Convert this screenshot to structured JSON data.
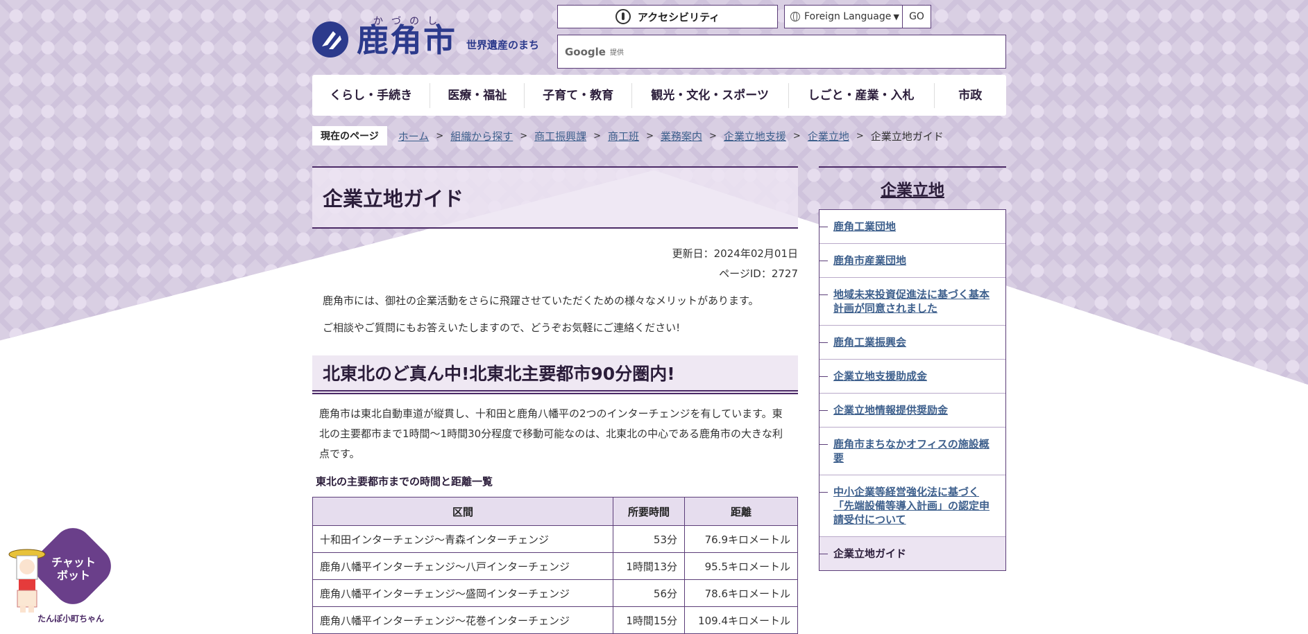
{
  "header": {
    "logo_ruby": "かづのし",
    "logo_name": "鹿角市",
    "logo_sub": "世界遺産のまち",
    "accessibility_label": "アクセシビリティ",
    "language_label": "Foreign Language",
    "go_label": "GO",
    "search_brand": "Google",
    "search_provided": "提供"
  },
  "nav": {
    "items": [
      "くらし・手続き",
      "医療・福祉",
      "子育て・教育",
      "観光・文化・スポーツ",
      "しごと・産業・入札",
      "市政"
    ]
  },
  "breadcrumb": {
    "current_label": "現在のページ",
    "items": [
      "ホーム",
      "組織から探す",
      "商工振興課",
      "商工班",
      "業務案内",
      "企業立地支援",
      "企業立地"
    ],
    "last": "企業立地ガイド"
  },
  "main": {
    "title": "企業立地ガイド",
    "updated": "更新日：2024年02月01日",
    "page_id": "ページID：2727",
    "intro1": "鹿角市には、御社の企業活動をさらに飛躍させていただくための様々なメリットがあります。",
    "intro2": "ご相談やご質問にもお答えいたしますので、どうぞお気軽にご連絡ください!",
    "section_title": "北東北のど真ん中!北東北主要都市90分圏内!",
    "section_text": " 鹿角市は東北自動車道が縦貫し、十和田と鹿角八幡平の2つのインターチェンジを有しています。東北の主要都市まで1時間～1時間30分程度で移動可能なのは、北東北の中心である鹿角市の大きな利点です。",
    "table_caption": "東北の主要都市までの時間と距離一覧",
    "table": {
      "headers": [
        "区間",
        "所要時間",
        "距離"
      ],
      "rows": [
        [
          "十和田インターチェンジ～青森インターチェンジ",
          "53分",
          "76.9キロメートル"
        ],
        [
          "鹿角八幡平インターチェンジ～八戸インターチェンジ",
          "1時間13分",
          "95.5キロメートル"
        ],
        [
          "鹿角八幡平インターチェンジ～盛岡インターチェンジ",
          "56分",
          "78.6キロメートル"
        ],
        [
          "鹿角八幡平インターチェンジ～花巻インターチェンジ",
          "1時間15分",
          "109.4キロメートル"
        ]
      ]
    }
  },
  "sidebar": {
    "title": "企業立地",
    "items": [
      "鹿角工業団地",
      "鹿角市産業団地",
      "地域未来投資促進法に基づく基本計画が同意されました",
      "鹿角工業振興会",
      "企業立地支援助成金",
      "企業立地情報提供奨励金",
      "鹿角市まちなかオフィスの施設概要",
      "中小企業等経営強化法に基づく「先端設備等導入計画」の認定申請受付について"
    ],
    "current": "企業立地ガイド"
  },
  "chatbot": {
    "label_line1": "チャット",
    "label_line2": "ボット",
    "caption": "たんぽ小町ちゃん"
  },
  "colors": {
    "accent": "#4b2a66",
    "link": "#3d5f8c",
    "logo": "#2c3a8c",
    "chat": "#6a3f8a"
  }
}
